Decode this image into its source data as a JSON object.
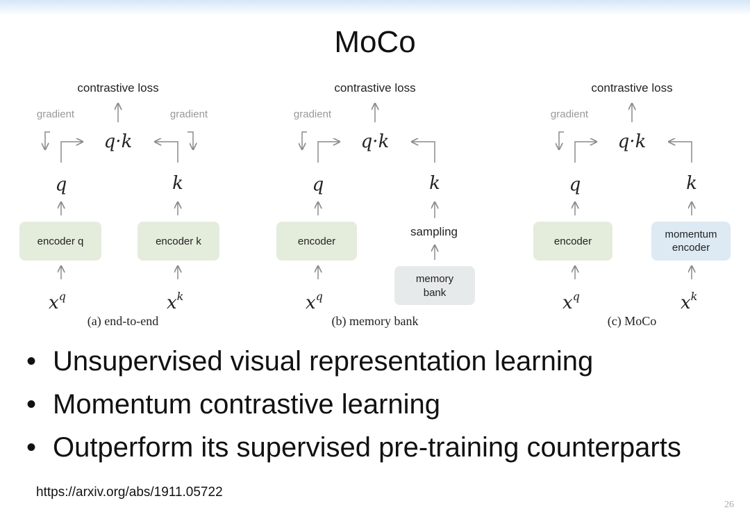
{
  "slide": {
    "title": "MoCo",
    "bullets": [
      "Unsupervised visual representation learning",
      "Momentum contrastive learning",
      "Outperform its supervised pre-training counterparts"
    ],
    "link": "https://arxiv.org/abs/1911.05722",
    "page_number": "26"
  },
  "diagram": {
    "panels": [
      {
        "caption": "(a) end-to-end",
        "loss": "contrastive loss",
        "gradient_left": "gradient",
        "gradient_right": "gradient",
        "qk": "q·k",
        "q": "q",
        "k": "k",
        "box_left": "encoder q",
        "box_right": "encoder k",
        "x_left": "x",
        "x_left_sup": "q",
        "x_right": "x",
        "x_right_sup": "k"
      },
      {
        "caption": "(b) memory bank",
        "loss": "contrastive loss",
        "gradient_left": "gradient",
        "qk": "q·k",
        "q": "q",
        "k": "k",
        "box_left": "encoder",
        "sampling": "sampling",
        "memory_line1": "memory",
        "memory_line2": "bank",
        "x_left": "x",
        "x_left_sup": "q"
      },
      {
        "caption": "(c) MoCo",
        "loss": "contrastive loss",
        "gradient_left": "gradient",
        "qk": "q·k",
        "q": "q",
        "k": "k",
        "box_left": "encoder",
        "box_right_line1": "momentum",
        "box_right_line2": "encoder",
        "x_left": "x",
        "x_left_sup": "q",
        "x_right": "x",
        "x_right_sup": "k"
      }
    ],
    "colors": {
      "encoder_box": "#e4ecdc",
      "memory_box": "#e6eaea",
      "momentum_box": "#dde9f3",
      "arrow": "#8a8a8a"
    }
  }
}
